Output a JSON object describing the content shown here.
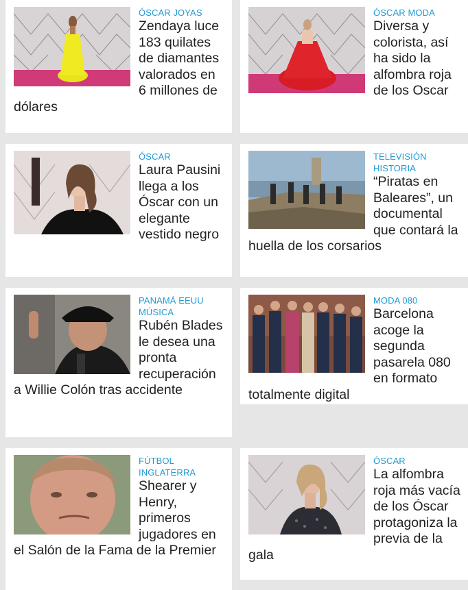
{
  "articles": [
    {
      "tags": [
        "ÓSCAR JOYAS"
      ],
      "title": "Zendaya luce 183 quilates de diamantes valorados en 6 millones de dólares",
      "image_alt": "Zendaya con vestido amarillo en la alfombra roja"
    },
    {
      "tags": [
        "ÓSCAR MODA"
      ],
      "title": "Diversa y colorista, así ha sido la alfombra roja de los Oscar",
      "image_alt": "Actriz con vestido rojo en la alfombra roja"
    },
    {
      "tags": [
        "ÓSCAR"
      ],
      "title": "Laura Pausini llega a los Óscar con un elegante vestido negro",
      "image_alt": "Laura Pausini con vestido negro"
    },
    {
      "tags": [
        "TELEVISIÓN",
        "HISTORIA"
      ],
      "title": "“Piratas en Baleares”, un documental que contará la huella de los corsarios",
      "image_alt": "Equipo de rodaje junto a una torre en la costa"
    },
    {
      "tags": [
        "PANAMÁ EEUU",
        "MÚSICA"
      ],
      "title": "Rubén Blades le desea una pronta recuperación a Willie Colón tras accidente",
      "image_alt": "Rubén Blades con gorra negra"
    },
    {
      "tags": [
        "MODA 080"
      ],
      "title": "Barcelona acoge la segunda pasarela 080 en formato totalmente digital",
      "image_alt": "Modelos en la pasarela 080"
    },
    {
      "tags": [
        "FÚTBOL",
        "INGLATERRA"
      ],
      "title": "Shearer y Henry, primeros jugadores en el Salón de la Fama de la Premier",
      "image_alt": "Alan Shearer"
    },
    {
      "tags": [
        "ÓSCAR"
      ],
      "title": "La alfombra roja más vacía de los Óscar protagoniza la previa de la gala",
      "image_alt": "Actriz con vestido de lentejuelas"
    }
  ]
}
